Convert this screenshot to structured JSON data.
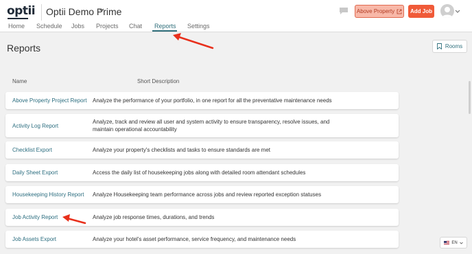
{
  "header": {
    "logo": "optii",
    "property": "Optii Demo Prime",
    "above_property_label": "Above Property",
    "add_job_label": "Add Job"
  },
  "nav": {
    "tabs": [
      {
        "label": "Home"
      },
      {
        "label": "Schedule"
      },
      {
        "label": "Jobs"
      },
      {
        "label": "Projects"
      },
      {
        "label": "Chat"
      },
      {
        "label": "Reports"
      },
      {
        "label": "Settings"
      }
    ],
    "active": "Reports"
  },
  "page": {
    "title": "Reports",
    "rooms_label": "Rooms",
    "col_name": "Name",
    "col_desc": "Short Description"
  },
  "reports": [
    {
      "name": "Above Property Project Report",
      "desc": "Analyze the performance of your portfolio, in one report for all the preventative maintenance needs"
    },
    {
      "name": "Activity Log Report",
      "desc": "Analyze, track and review all user and system activity to ensure transparency, resolve issues, and maintain operational accountability"
    },
    {
      "name": "Checklist Export",
      "desc": "Analyze your property's checklists and tasks to ensure standards are met"
    },
    {
      "name": "Daily Sheet Export",
      "desc": "Access the daily list of housekeeping jobs along with detailed room attendant schedules"
    },
    {
      "name": "Housekeeping History Report",
      "desc": "Analyze Housekeeping team performance across jobs and review reported exception statuses"
    },
    {
      "name": "Job Activity Report",
      "desc": "Analyze job response times, durations, and trends"
    },
    {
      "name": "Job Assets Export",
      "desc": "Analyze your hotel's asset performance, service frequency, and maintenance needs"
    }
  ],
  "language": "EN",
  "colors": {
    "accent": "#2f6e7a",
    "add_job": "#f05a38",
    "above_property_bg": "#f8b8a8",
    "annotation_arrow": "#e8301c"
  }
}
